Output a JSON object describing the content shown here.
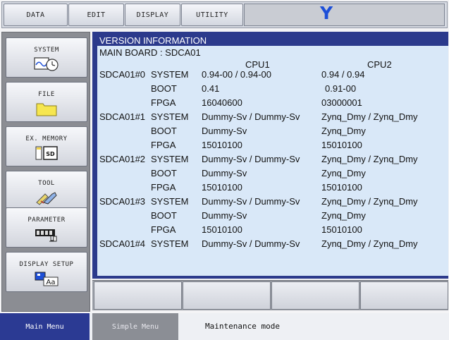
{
  "topbar": {
    "data_label": "DATA",
    "edit_label": "EDIT",
    "display_label": "DISPLAY",
    "utility_label": "UTILITY",
    "logo_text": "Y"
  },
  "sidemenu": {
    "system": "SYSTEM",
    "file": "FILE",
    "ex_memory": "EX. MEMORY",
    "tool": "TOOL",
    "parameter": "PARAMETER",
    "display_setup": "DISPLAY SETUP"
  },
  "panel": {
    "title": "VERSION INFORMATION",
    "main_board": "MAIN BOARD : SDCA01",
    "cpu1_header": "CPU1",
    "cpu2_header": "CPU2",
    "rows": [
      {
        "board": "SDCA01#0",
        "item": "SYSTEM",
        "cpu1": "0.94-00 /  0.94-00",
        "cpu2": "0.94    /  0.94"
      },
      {
        "board": "",
        "item": "BOOT",
        "cpu1": "0.41",
        "cpu2": "0.91-00"
      },
      {
        "board": "",
        "item": "FPGA",
        "cpu1": "16040600",
        "cpu2": "03000001"
      },
      {
        "board": "SDCA01#1",
        "item": "SYSTEM",
        "cpu1": "Dummy-Sv / Dummy-Sv",
        "cpu2": "Zynq_Dmy / Zynq_Dmy"
      },
      {
        "board": "",
        "item": "BOOT",
        "cpu1": "Dummy-Sv",
        "cpu2": "Zynq_Dmy"
      },
      {
        "board": "",
        "item": "FPGA",
        "cpu1": "15010100",
        "cpu2": "15010100"
      },
      {
        "board": "SDCA01#2",
        "item": "SYSTEM",
        "cpu1": "Dummy-Sv / Dummy-Sv",
        "cpu2": "Zynq_Dmy / Zynq_Dmy"
      },
      {
        "board": "",
        "item": "BOOT",
        "cpu1": "Dummy-Sv",
        "cpu2": "Zynq_Dmy"
      },
      {
        "board": "",
        "item": "FPGA",
        "cpu1": "15010100",
        "cpu2": "15010100"
      },
      {
        "board": "SDCA01#3",
        "item": "SYSTEM",
        "cpu1": "Dummy-Sv / Dummy-Sv",
        "cpu2": "Zynq_Dmy / Zynq_Dmy"
      },
      {
        "board": "",
        "item": "BOOT",
        "cpu1": "Dummy-Sv",
        "cpu2": "Zynq_Dmy"
      },
      {
        "board": "",
        "item": "FPGA",
        "cpu1": "15010100",
        "cpu2": "15010100"
      },
      {
        "board": "SDCA01#4",
        "item": "SYSTEM",
        "cpu1": "Dummy-Sv / Dummy-Sv",
        "cpu2": "Zynq_Dmy / Zynq_Dmy"
      }
    ]
  },
  "bottombar": {
    "main_menu": "Main Menu",
    "simple_menu": "Simple Menu",
    "status": "Maintenance mode"
  },
  "colors": {
    "accent": "#2c3a8c",
    "panel_bg": "#d9e8f8",
    "logo": "#1d4fd8"
  }
}
